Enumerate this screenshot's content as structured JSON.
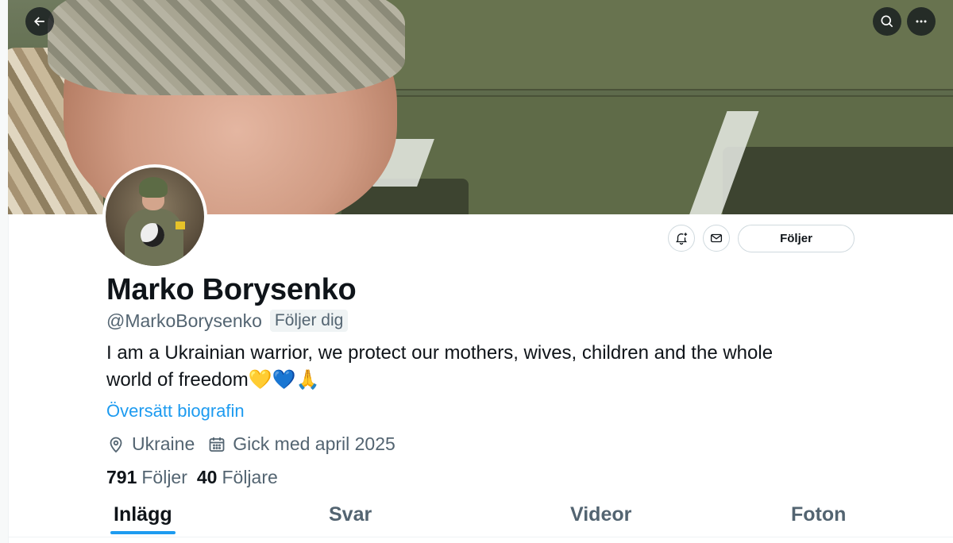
{
  "header": {
    "back_icon": "arrow-left-icon",
    "search_icon": "search-icon",
    "more_icon": "more-dots-icon"
  },
  "profile": {
    "name": "Marko Borysenko",
    "handle": "@MarkoBorysenko",
    "follows_you": "Följer dig",
    "bio_line1": "I am a Ukrainian warrior, we protect our mothers, wives, children and the whole",
    "bio_line2": "world of freedom💛💙🙏",
    "translate_link": "Översätt biografin",
    "location": "Ukraine",
    "joined": "Gick med april 2025"
  },
  "actions": {
    "notify_icon": "bell-plus-icon",
    "message_icon": "envelope-icon",
    "follow_label": "Följer"
  },
  "stats": {
    "following_count": "791",
    "following_label": "Följer",
    "followers_count": "40",
    "followers_label": "Följare"
  },
  "tabs": [
    {
      "label": "Inlägg",
      "active": true
    },
    {
      "label": "Svar",
      "active": false
    },
    {
      "label": "Videor",
      "active": false
    },
    {
      "label": "Foton",
      "active": false
    }
  ],
  "colors": {
    "accent": "#1d9bf0",
    "text_primary": "#0f1419",
    "text_secondary": "#536471"
  }
}
